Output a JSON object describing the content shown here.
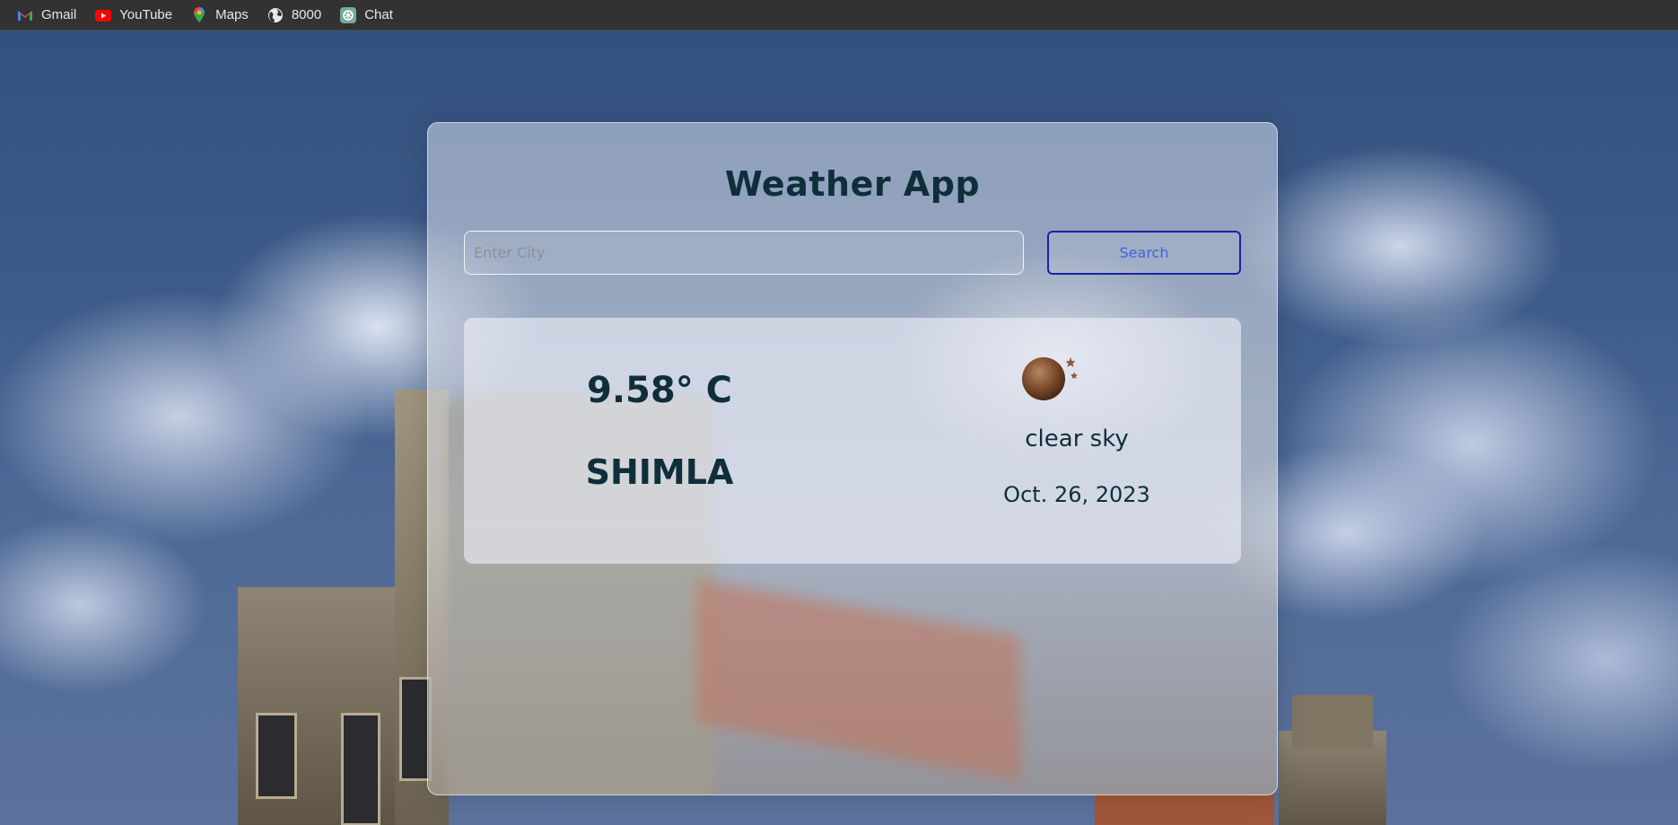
{
  "bookmarks": [
    {
      "label": "Gmail",
      "icon": "gmail-icon"
    },
    {
      "label": "YouTube",
      "icon": "youtube-icon"
    },
    {
      "label": "Maps",
      "icon": "maps-icon"
    },
    {
      "label": "8000",
      "icon": "globe-icon"
    },
    {
      "label": "Chat",
      "icon": "chat-icon"
    }
  ],
  "app": {
    "title": "Weather App",
    "search": {
      "placeholder": "Enter City",
      "value": "",
      "button_label": "Search"
    },
    "result": {
      "temperature": "9.58° C",
      "city": "SHIMLA",
      "description": "clear sky",
      "date": "Oct. 26, 2023",
      "icon": "night-clear-icon"
    }
  },
  "colors": {
    "heading": "#0e2f3a",
    "button_border": "#1524a8",
    "button_text": "#3e63e0",
    "bookmark_bar": "#323232"
  }
}
